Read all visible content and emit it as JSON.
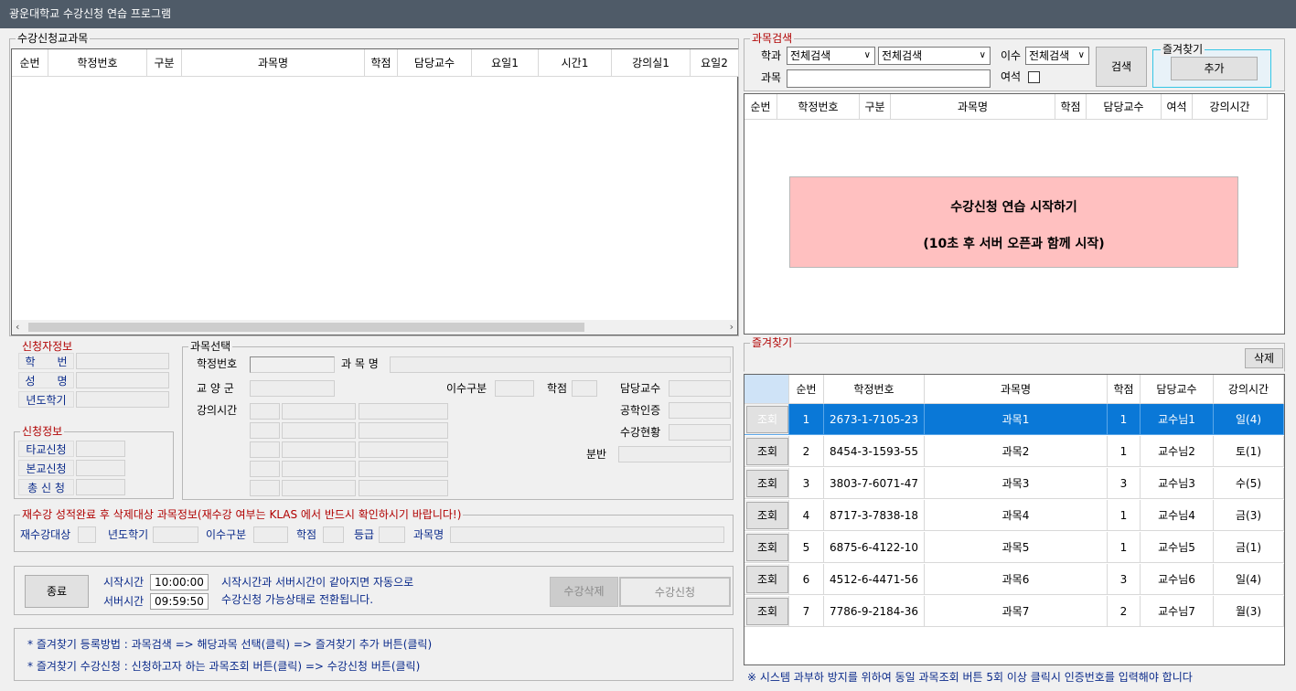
{
  "app": {
    "title": "광운대학교 수강신청 연습 프로그램"
  },
  "enrolled": {
    "label": "수강신청교과목",
    "columns": [
      "순번",
      "학정번호",
      "구분",
      "과목명",
      "학점",
      "담당교수",
      "요일1",
      "시간1",
      "강의실1",
      "요일2"
    ]
  },
  "search": {
    "label": "과목검색",
    "dept_label": "학과",
    "dept_value1": "전체검색",
    "dept_value2": "전체검색",
    "isu_label": "이수",
    "isu_value": "전체검색",
    "course_label": "과목",
    "course_value": "",
    "seat_label": "여석",
    "search_button": "검색",
    "fav_group_label": "즐겨찾기",
    "add_button": "추가",
    "columns": [
      "순번",
      "학정번호",
      "구분",
      "과목명",
      "학점",
      "담당교수",
      "여석",
      "강의시간"
    ],
    "start_line1": "수강신청 연습 시작하기",
    "start_line2": "(10초 후 서버 오픈과 함께 시작)"
  },
  "applicant": {
    "label": "신청자정보",
    "fields": [
      "학　　번",
      "성　　명",
      "년도학기"
    ]
  },
  "apply_info": {
    "label": "신청정보",
    "fields": [
      "타교신청",
      "본교신청",
      "총 신 청"
    ]
  },
  "selection": {
    "label": "과목선택",
    "course_no": "학정번호",
    "course_name": "과 목 명",
    "liberal": "교 양 군",
    "isu_type": "이수구분",
    "credit": "학점",
    "professor": "담당교수",
    "lecture_time": "강의시간",
    "engineering_cert": "공학인증",
    "enroll_status": "수강현황",
    "section": "분반"
  },
  "retake": {
    "label": "재수강 성적완료 후 삭제대상 과목정보(재수강 여부는 KLAS 에서 반드시 확인하시기 바랍니다!)",
    "target": "재수강대상",
    "year_sem": "년도학기",
    "isu_type": "이수구분",
    "credit": "학점",
    "grade": "등급",
    "course_name": "과목명"
  },
  "control": {
    "exit_button": "종료",
    "start_time_label": "시작시간",
    "start_time": "10:00:00",
    "server_time_label": "서버시간",
    "server_time": "09:59:50",
    "note_line1": "시작시간과 서버시간이 같아지면 자동으로",
    "note_line2": "수강신청 가능상태로 전환됩니다.",
    "drop_button": "수강삭제",
    "apply_button": "수강신청"
  },
  "help": {
    "line1": "* 즐겨찾기 등록방법 : 과목검색 => 해당과목 선택(클릭) => 즐겨찾기 추가 버튼(클릭)",
    "line2": "* 즐겨찾기 수강신청 : 신청하고자 하는 과목조회 버튼(클릭) => 수강신청 버튼(클릭)"
  },
  "favorites": {
    "label": "즐겨찾기",
    "delete_button": "삭제",
    "columns": [
      "",
      "순번",
      "학정번호",
      "과목명",
      "학점",
      "담당교수",
      "강의시간"
    ],
    "view_button": "조회",
    "rows": [
      {
        "no": "1",
        "code": "2673-1-7105-23",
        "name": "과목1",
        "credit": "1",
        "prof": "교수님1",
        "time": "일(4)"
      },
      {
        "no": "2",
        "code": "8454-3-1593-55",
        "name": "과목2",
        "credit": "1",
        "prof": "교수님2",
        "time": "토(1)"
      },
      {
        "no": "3",
        "code": "3803-7-6071-47",
        "name": "과목3",
        "credit": "3",
        "prof": "교수님3",
        "time": "수(5)"
      },
      {
        "no": "4",
        "code": "8717-3-7838-18",
        "name": "과목4",
        "credit": "1",
        "prof": "교수님4",
        "time": "금(3)"
      },
      {
        "no": "5",
        "code": "6875-6-4122-10",
        "name": "과목5",
        "credit": "1",
        "prof": "교수님5",
        "time": "금(1)"
      },
      {
        "no": "6",
        "code": "4512-6-4471-56",
        "name": "과목6",
        "credit": "3",
        "prof": "교수님6",
        "time": "일(4)"
      },
      {
        "no": "7",
        "code": "7786-9-2184-36",
        "name": "과목7",
        "credit": "2",
        "prof": "교수님7",
        "time": "월(3)"
      }
    ],
    "selected_index": 0,
    "notice": "※ 시스템 과부하 방지를 위하여 동일 과목조회 버튼 5회 이상 클릭시 인증번호를 입력해야 합니다"
  },
  "colors": {
    "titlebar": "#4f5b68",
    "selected_row": "#0a78d7",
    "start_box": "#ffc0c0",
    "label_red": "#b00000",
    "label_navy": "#0a2a8a"
  }
}
